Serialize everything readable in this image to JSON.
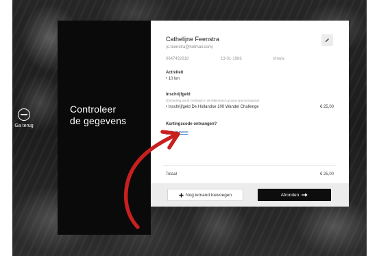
{
  "back": {
    "label": "Ga terug",
    "icon": "back-circle-icon"
  },
  "heading": {
    "line1": "Controleer",
    "line2": "de gegevens"
  },
  "participant": {
    "name": "Cathelijne Feenstra",
    "email": "(c.feenstra@hotmail.com)",
    "phone": "0647432918",
    "birthdate": "13-01-1986",
    "gender": "Vrouw"
  },
  "activity": {
    "title": "Activiteit",
    "value": "• 10 km"
  },
  "fee": {
    "title": "Inschrijfgeld",
    "note": "(Dit bedrag wordt zichtbaar in de tellerstand op jouw sponsorpagina)",
    "item": "• Inschrijfgeld De Hollandse 100 Wandel Challenge",
    "price": "€ 25,00"
  },
  "discount": {
    "title": "Kortingscode ontvangen?",
    "link": "Code invoeren"
  },
  "total": {
    "label": "Totaal",
    "value": "€ 25,00"
  },
  "actions": {
    "add_label": "Nog iemand toevoegen",
    "finish_label": "Afronden"
  },
  "colors": {
    "accent_arrow": "#c8201f",
    "link": "#1a5fb4",
    "panel": "#0a0a0a"
  }
}
